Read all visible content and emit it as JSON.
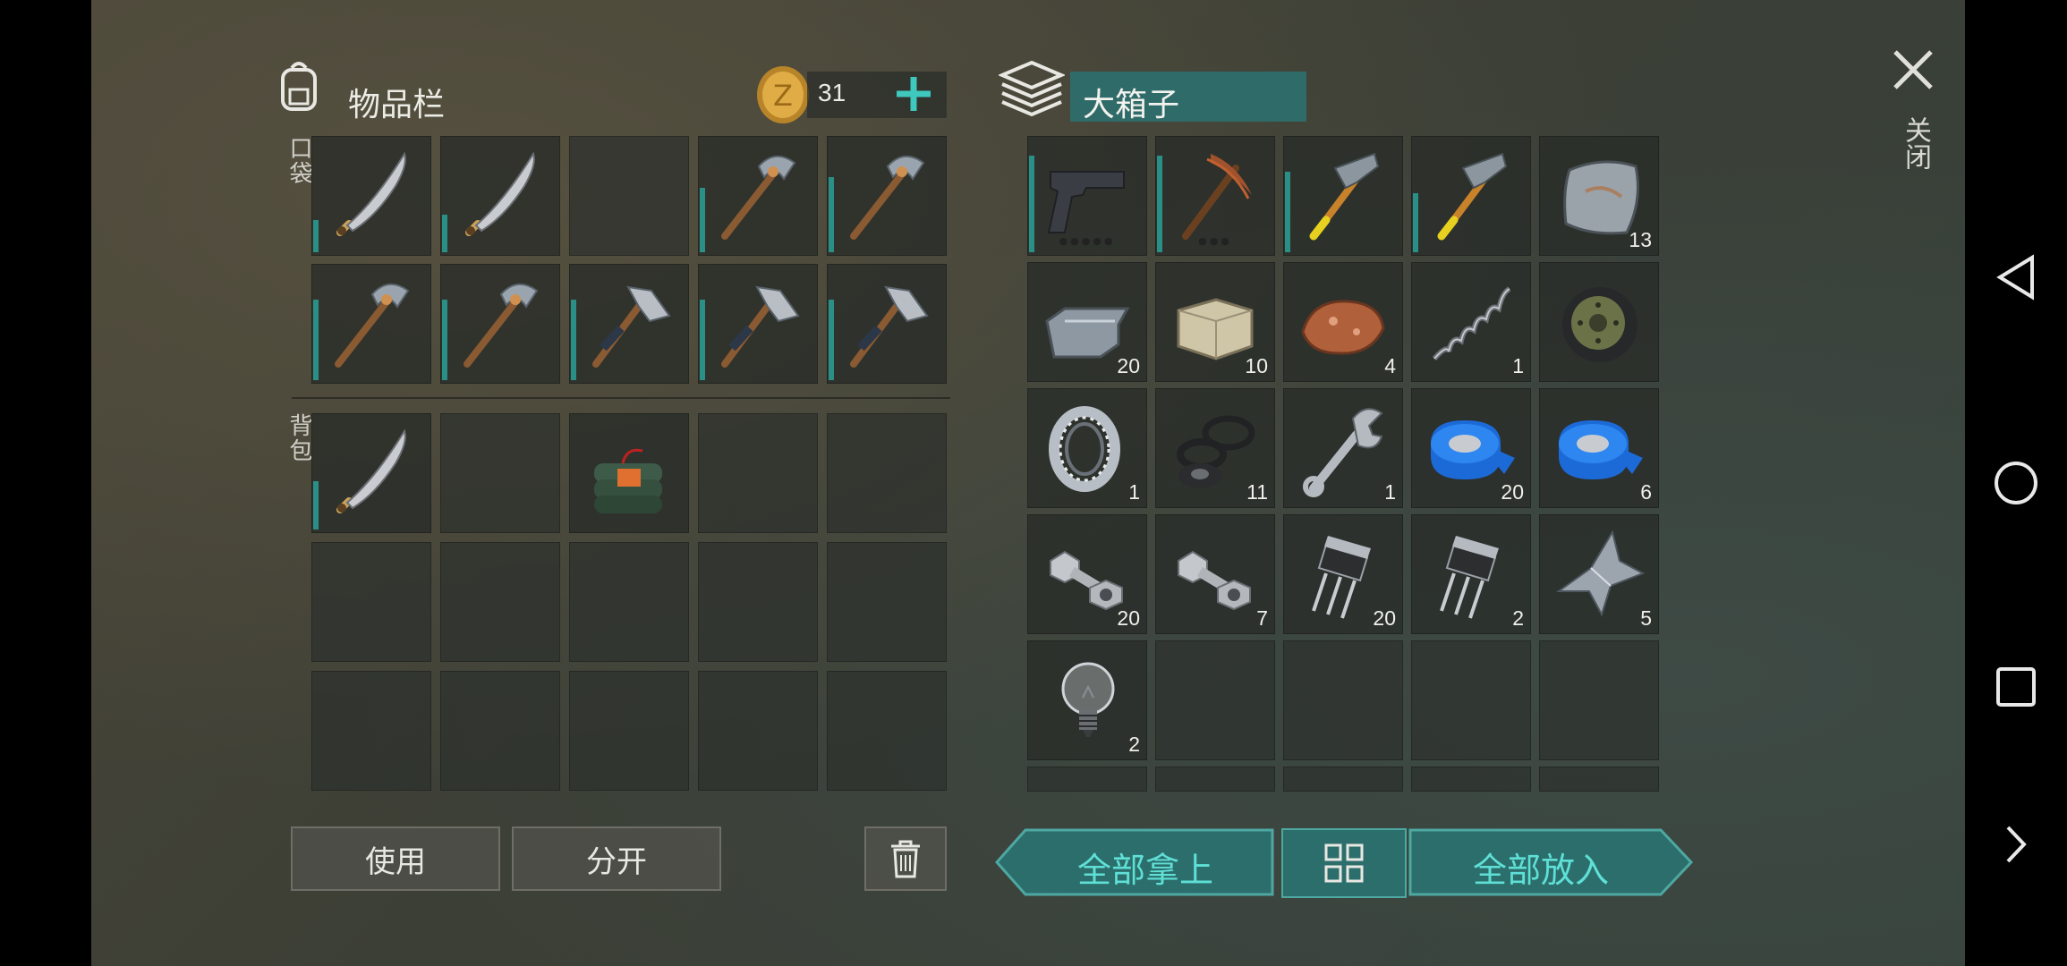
{
  "inventory": {
    "title": "物品栏",
    "coins": "31",
    "pocket_label": "口袋",
    "backpack_label": "背包",
    "use_label": "使用",
    "split_label": "分开"
  },
  "container": {
    "title": "大箱子",
    "take_all_label": "全部拿上",
    "put_all_label": "全部放入"
  },
  "close_label": "关闭",
  "pocket_items": [
    {
      "icon": "machete-icon",
      "durability": 0.3
    },
    {
      "icon": "machete-icon",
      "durability": 0.35
    },
    {
      "icon": "",
      "durability": 0
    },
    {
      "icon": "stone-pickaxe-icon",
      "durability": 0.6
    },
    {
      "icon": "stone-pickaxe-icon",
      "durability": 0.7
    },
    {
      "icon": "stone-pickaxe-icon",
      "durability": 0.75
    },
    {
      "icon": "stone-pickaxe-icon",
      "durability": 0.75
    },
    {
      "icon": "stone-axe-icon",
      "durability": 0.75
    },
    {
      "icon": "stone-axe-icon",
      "durability": 0.75
    },
    {
      "icon": "stone-axe-icon",
      "durability": 0.75
    }
  ],
  "backpack_items": [
    {
      "icon": "machete-icon",
      "durability": 0.45
    },
    {
      "icon": "",
      "durability": 0
    },
    {
      "icon": "dynamite-bundle-icon",
      "durability": 0
    }
  ],
  "container_items": [
    {
      "icon": "pistol-icon",
      "count": "",
      "durability": 0.9,
      "ammo": "●●●●●"
    },
    {
      "icon": "pickaxe-icon",
      "count": "",
      "durability": 0.9,
      "ammo": "●●●"
    },
    {
      "icon": "hammer-icon",
      "count": "",
      "durability": 0.75
    },
    {
      "icon": "hammer-icon",
      "count": "",
      "durability": 0.55
    },
    {
      "icon": "metal-plate-icon",
      "count": "13"
    },
    {
      "icon": "iron-ingot-icon",
      "count": "20"
    },
    {
      "icon": "stone-block-icon",
      "count": "10"
    },
    {
      "icon": "iron-ore-icon",
      "count": "4"
    },
    {
      "icon": "spring-icon",
      "count": "1"
    },
    {
      "icon": "tire-icon",
      "count": ""
    },
    {
      "icon": "bearing-icon",
      "count": "1"
    },
    {
      "icon": "rubber-seal-icon",
      "count": "11"
    },
    {
      "icon": "wrench-icon",
      "count": "1"
    },
    {
      "icon": "blue-tape-icon",
      "count": "20"
    },
    {
      "icon": "blue-tape-icon",
      "count": "6"
    },
    {
      "icon": "bolt-nut-icon",
      "count": "20"
    },
    {
      "icon": "bolt-nut-icon",
      "count": "7"
    },
    {
      "icon": "transistor-icon",
      "count": "20"
    },
    {
      "icon": "transistor-icon",
      "count": "2"
    },
    {
      "icon": "metal-scrap-icon",
      "count": "5"
    },
    {
      "icon": "light-bulb-icon",
      "count": "2"
    }
  ],
  "colors": {
    "accent": "#2c6e6c",
    "accent_text": "#5fe0d6",
    "durability": "#2a8f86"
  }
}
